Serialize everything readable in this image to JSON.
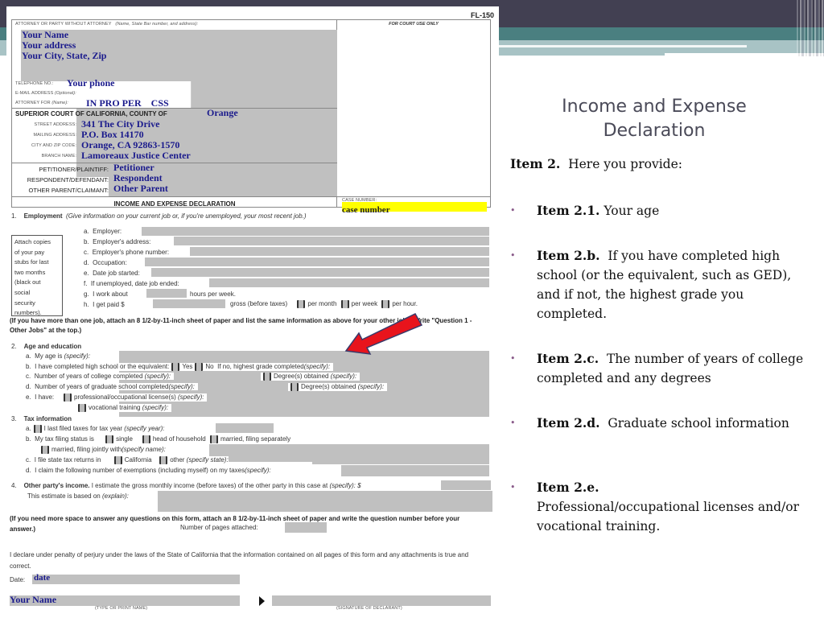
{
  "form": {
    "form_id": "FL-150",
    "attorney_label": "ATTORNEY OR PARTY WITHOUT ATTORNEY",
    "attorney_hint": "(Name, State Bar number, and address):",
    "for_court_use": "FOR COURT USE ONLY",
    "name": "Your Name",
    "address": "Your address",
    "city_state_zip": "Your City, State, Zip",
    "telephone_label": "TELEPHONE NO.:",
    "telephone": "Your phone",
    "email_label": "E-MAIL ADDRESS",
    "email_hint": "(Optional):",
    "attorney_for_label": "ATTORNEY FOR",
    "attorney_for_hint": "(Name):",
    "attorney_for": "IN PRO PER    CSS",
    "court_label": "SUPERIOR COURT OF CALIFORNIA, COUNTY OF",
    "county": "Orange",
    "street_label": "STREET ADDRESS:",
    "street": "341 The City Drive",
    "mailing_label": "MAILING ADDRESS:",
    "mailing": "P.O. Box 14170",
    "city_zip_label": "CITY AND ZIP CODE:",
    "city_zip": "Orange, CA 92863-1570",
    "branch_label": "BRANCH NAME:",
    "branch": "Lamoreaux Justice Center",
    "petitioner_label": "PETITIONER/PLAINTIFF:",
    "petitioner": "Petitioner",
    "respondent_label": "RESPONDENT/DEFENDANT:",
    "respondent": "Respondent",
    "other_parent_label": "OTHER PARENT/CLAIMANT:",
    "other_parent": "Other Parent",
    "doc_title": "INCOME AND EXPENSE DECLARATION",
    "case_number_label": "CASE NUMBER:",
    "case_number": "case number",
    "section1": {
      "num": "1.",
      "title": "Employment",
      "hint": "(Give information on your current job or, if you're unemployed, your most recent job.)",
      "attach_note": [
        "Attach copies",
        "of your pay",
        "stubs for last",
        "two months",
        "(black out",
        "social",
        "security",
        "numbers)."
      ],
      "items": [
        {
          "letter": "a.",
          "label": "Employer:"
        },
        {
          "letter": "b.",
          "label": "Employer's address:"
        },
        {
          "letter": "c.",
          "label": "Employer's phone number:"
        },
        {
          "letter": "d.",
          "label": "Occupation:"
        },
        {
          "letter": "e.",
          "label": "Date job started:"
        },
        {
          "letter": "f.",
          "label": "If unemployed, date job ended:"
        }
      ],
      "g_letter": "g.",
      "g_pre": "I work about",
      "g_post": "hours per week.",
      "h_letter": "h.",
      "h_pre": "I get paid $",
      "h_gross": "gross (before taxes)",
      "h_per_month": "per month",
      "h_per_week": "per week",
      "h_per_hour": "per hour.",
      "more_jobs": "(If you have more than one job, attach an 8 1/2-by-11-inch sheet of paper and list the same information as above for your other jobs. Write \"Question 1 - Other Jobs\" at the top.)"
    },
    "section2": {
      "num": "2.",
      "title": "Age and education",
      "a_letter": "a.",
      "a_label": "My age is",
      "a_hint": "(specify):",
      "b_letter": "b.",
      "b_label": "I have completed high school or the equivalent:",
      "b_yes": "Yes",
      "b_no": "No",
      "b_if_no": "If no, highest grade completed",
      "b_hint": "(specify):",
      "c_letter": "c.",
      "c_label": "Number of years of college completed",
      "c_hint": "(specify):",
      "c_degree": "Degree(s) obtained",
      "c_degree_hint": "(specify):",
      "d_letter": "d.",
      "d_label": "Number of years of graduate school completed",
      "d_hint": "(specify):",
      "d_degree": "Degree(s) obtained",
      "d_degree_hint": "(specify):",
      "e_letter": "e.",
      "e_label": "I have:",
      "e_license": "professional/occupational license(s)",
      "e_license_hint": "(specify):",
      "e_vocational": "vocational training",
      "e_vocational_hint": "(specify):"
    },
    "section3": {
      "num": "3.",
      "title": "Tax information",
      "a_letter": "a.",
      "a_label": "I last filed taxes for tax year",
      "a_hint": "(specify year):",
      "b_letter": "b.",
      "b_label": "My tax filing status is",
      "b_single": "single",
      "b_hoh": "head of household",
      "b_mfs": "married, filing separately",
      "b_mfj": "married, filing jointly with",
      "b_mfj_hint": "(specify name):",
      "c_letter": "c.",
      "c_label": "I file state tax returns in",
      "c_ca": "California",
      "c_other": "other",
      "c_other_hint": "(specify state):",
      "d_letter": "d.",
      "d_label": "I claim the following number of exemptions (including myself) on my taxes",
      "d_hint": "(specify):"
    },
    "section4": {
      "num": "4.",
      "title": "Other party's income.",
      "text": "I estimate the gross monthly income (before taxes) of the other party in this case at",
      "hint": "(specify): $",
      "basis": "This estimate is based on",
      "basis_hint": "(explain):"
    },
    "more_space": "(If you need more space to answer any questions on this form, attach an 8 1/2-by-11-inch sheet of paper and write the question number before your answer.)",
    "pages_attached": "Number of pages attached:",
    "declare": "I declare under penalty of perjury under the laws of the State of California that the information contained on all pages of this form and any attachments is true and correct.",
    "date_label": "Date:",
    "date_value": "date",
    "sign_name": "Your Name",
    "type_name_caption": "(TYPE OR PRINT NAME)",
    "signature_caption": "(SIGNATURE OF DECLARANT)"
  },
  "slide": {
    "title_line1": "Income and Expense",
    "title_line2": "Declaration",
    "intro_bold": "Item 2.",
    "intro_text": "Here you provide:",
    "bullet_char": "•",
    "bullets": [
      {
        "bold": "Item 2.1.",
        "text": "Your age"
      },
      {
        "bold": "Item 2.b.",
        "text": "If you have completed high school (or the equivalent, such as GED), and if not, the highest grade you completed."
      },
      {
        "bold": "Item 2.c.",
        "text": "The number of years of college completed and any degrees"
      },
      {
        "bold": "Item 2.d.",
        "text": "Graduate school information"
      },
      {
        "bold": "Item 2.e.",
        "text": "Professional/occupational  licenses and/or vocational training."
      }
    ]
  },
  "colors": {
    "header_dark": "#424052",
    "header_teal": "#4a7f80",
    "header_light": "#a8c3c5",
    "field_gray": "#c0c0c0",
    "fill_blue": "#1a1a8c",
    "case_yellow": "#ffff00",
    "arrow_red": "#e8141c"
  }
}
